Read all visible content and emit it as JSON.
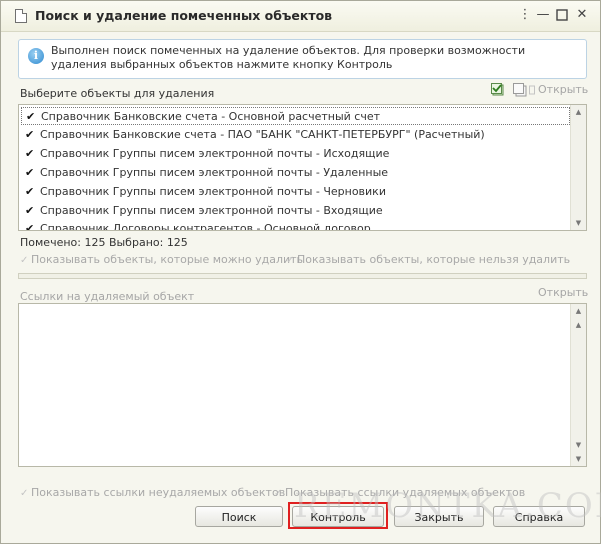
{
  "window": {
    "title": "Поиск и удаление помеченных объектов"
  },
  "info": {
    "text": "Выполнен поиск помеченных на удаление объектов. Для проверки возможности удаления выбранных объектов нажмите кнопку Контроль"
  },
  "select_section": {
    "label": "Выберите объекты для удаления",
    "open_label": "Открыть"
  },
  "objects": [
    {
      "label": "Справочник Банковские счета - Основной расчетный счет",
      "checked": true
    },
    {
      "label": "Справочник Банковские счета - ПАО \"БАНК \"САНКТ-ПЕТЕРБУРГ\" (Расчетный)",
      "checked": true
    },
    {
      "label": "Справочник Группы писем электронной почты - Исходящие",
      "checked": true
    },
    {
      "label": "Справочник Группы писем электронной почты - Удаленные",
      "checked": true
    },
    {
      "label": "Справочник Группы писем электронной почты - Черновики",
      "checked": true
    },
    {
      "label": "Справочник Группы писем электронной почты - Входящие",
      "checked": true
    },
    {
      "label": "Справочник Договоры контрагентов - Основной договор",
      "checked": true
    }
  ],
  "counts": {
    "text": "Помечено: 125  Выбрано: 125"
  },
  "filters": {
    "show_deletable": "Показывать объекты, которые можно удалить",
    "show_non_deletable": "Показывать объекты, которые нельзя удалить"
  },
  "references": {
    "label": "Ссылки на удаляемый объект",
    "open_label": "Открыть",
    "show_refs_non_deletable": "Показывать ссылки неудаляемых объектов",
    "show_refs_deletable": "Показывать ссылки удаляемых объектов"
  },
  "buttons": {
    "search": "Поиск",
    "control": "Контроль",
    "close": "Закрыть",
    "help": "Справка"
  },
  "watermark": "REMONTKA.COM"
}
